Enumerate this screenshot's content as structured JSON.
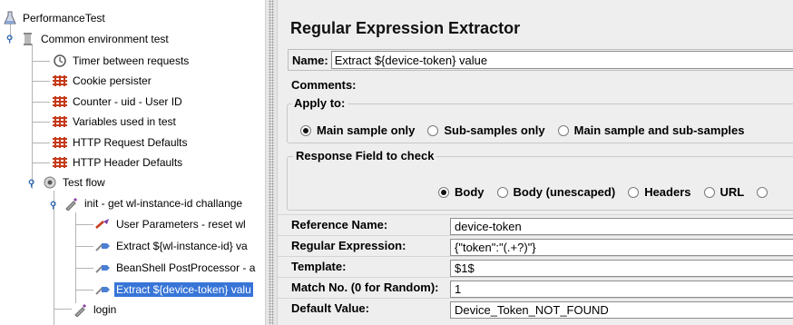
{
  "tree": {
    "root": "PerformanceTest",
    "common": "Common environment test",
    "items": [
      "Timer between requests",
      "Cookie persister",
      "Counter - uid - User ID",
      "Variables used in test",
      "HTTP Request Defaults",
      "HTTP Header Defaults"
    ],
    "test_flow": "Test flow",
    "init": "init - get wl-instance-id challange",
    "init_children": [
      "User Parameters - reset wl",
      "Extract ${wl-instance-id} va",
      "BeanShell PostProcessor - a",
      "Extract ${device-token} valu"
    ],
    "login": "login"
  },
  "panel": {
    "title": "Regular Expression Extractor",
    "name_label": "Name:",
    "name_value": "Extract ${device-token} value",
    "comments_label": "Comments:",
    "apply_to": {
      "title": "Apply to:",
      "options": [
        "Main sample only",
        "Sub-samples only",
        "Main sample and sub-samples"
      ],
      "selected": "Main sample only"
    },
    "response_field": {
      "title": "Response Field to check",
      "options": [
        "Body",
        "Body (unescaped)",
        "Headers",
        "URL"
      ],
      "selected": "Body"
    },
    "fields": {
      "reference_name": {
        "label": "Reference Name:",
        "value": "device-token"
      },
      "regex": {
        "label": "Regular Expression:",
        "value": "{\"token\":\"(.+?)\"}"
      },
      "template": {
        "label": "Template:",
        "value": "$1$"
      },
      "match_no": {
        "label": "Match No. (0 for Random):",
        "value": "1"
      },
      "default_value": {
        "label": "Default Value:",
        "value": "Device_Token_NOT_FOUND"
      }
    }
  }
}
